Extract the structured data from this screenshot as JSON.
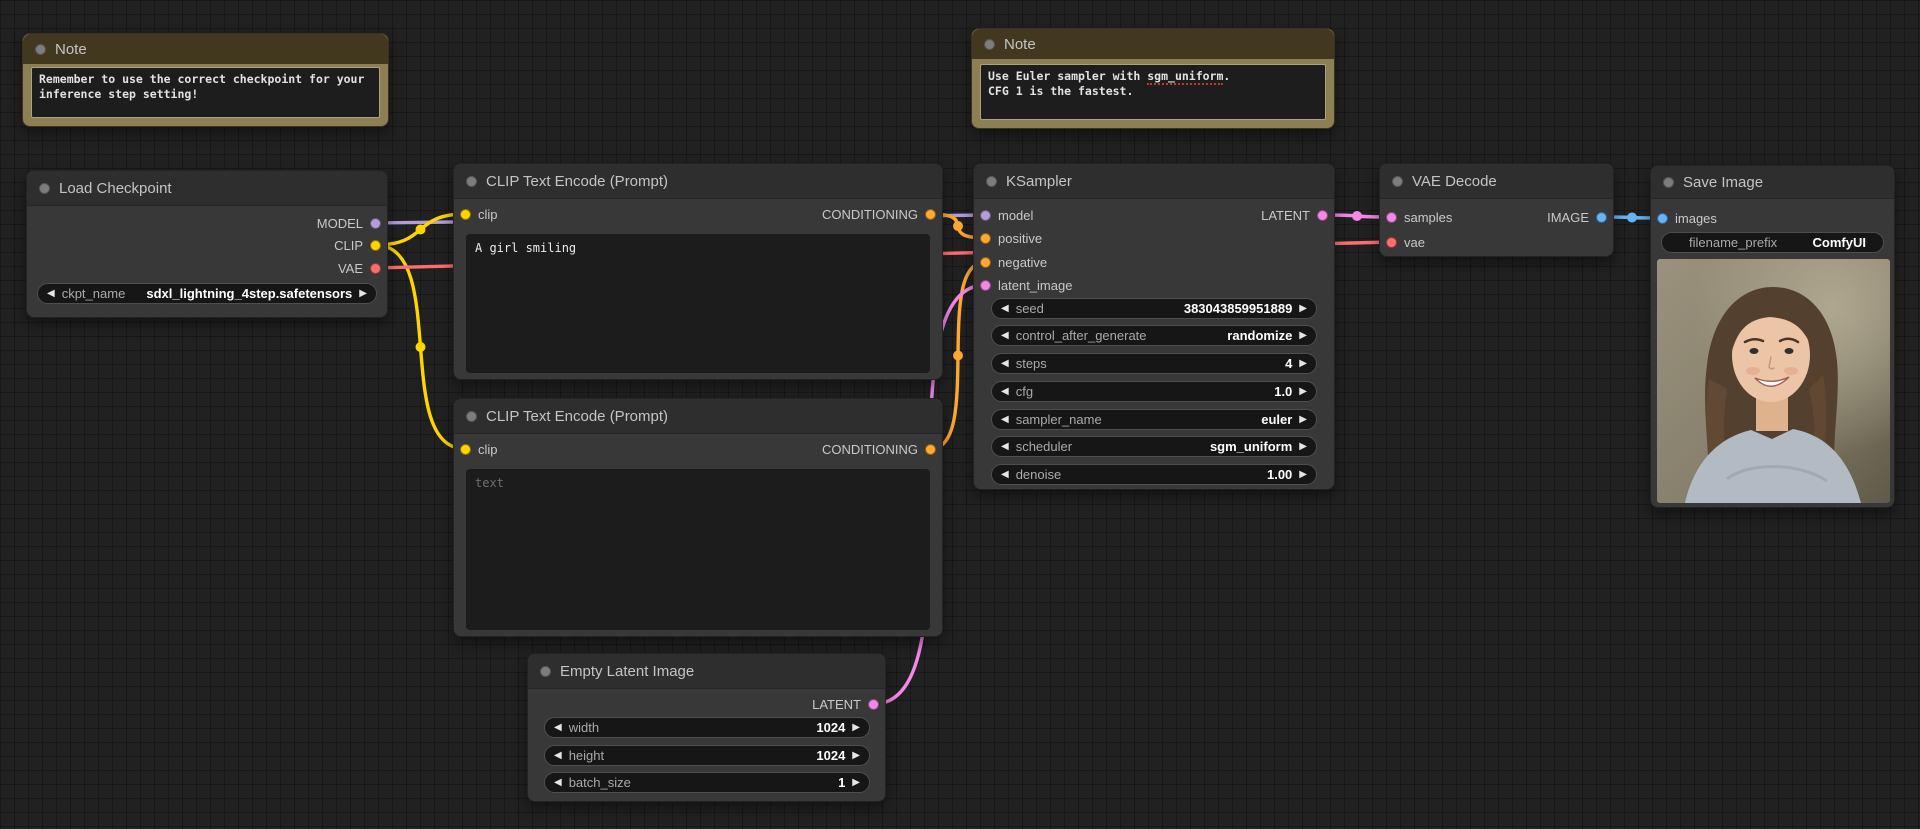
{
  "icons": {
    "arrow_left": "◀",
    "arrow_right": "▶"
  },
  "type_colors": {
    "MODEL": "#B39DDB",
    "CLIP": "#FFD500",
    "VAE": "#FF6E6E",
    "CONDITIONING": "#FFA931",
    "LATENT": "#F487E8",
    "IMAGE": "#64B5F6"
  },
  "nodes": {
    "note1": {
      "title": "Note",
      "text": "Remember to use the correct checkpoint for your inference step setting!"
    },
    "note2": {
      "title": "Note",
      "line1_pre": "Use Euler sampler with ",
      "line1_mark": "sgm_uniform",
      "line1_post": ".",
      "line2": "CFG 1 is the fastest."
    },
    "load_checkpoint": {
      "title": "Load Checkpoint",
      "outputs": [
        "MODEL",
        "CLIP",
        "VAE"
      ],
      "widget": {
        "label": "ckpt_name",
        "value": "sdxl_lightning_4step.safetensors"
      }
    },
    "clip_positive": {
      "title": "CLIP Text Encode (Prompt)",
      "input": "clip",
      "output": "CONDITIONING",
      "text": "A girl smiling"
    },
    "clip_negative": {
      "title": "CLIP Text Encode (Prompt)",
      "input": "clip",
      "output": "CONDITIONING",
      "placeholder": "text"
    },
    "ksampler": {
      "title": "KSampler",
      "inputs": [
        "model",
        "positive",
        "negative",
        "latent_image"
      ],
      "output": "LATENT",
      "widgets": [
        {
          "label": "seed",
          "value": "383043859951889"
        },
        {
          "label": "control_after_generate",
          "value": "randomize"
        },
        {
          "label": "steps",
          "value": "4"
        },
        {
          "label": "cfg",
          "value": "1.0"
        },
        {
          "label": "sampler_name",
          "value": "euler"
        },
        {
          "label": "scheduler",
          "value": "sgm_uniform"
        },
        {
          "label": "denoise",
          "value": "1.00"
        }
      ]
    },
    "vae_decode": {
      "title": "VAE Decode",
      "inputs": [
        "samples",
        "vae"
      ],
      "output": "IMAGE"
    },
    "save_image": {
      "title": "Save Image",
      "input": "images",
      "widget": {
        "label": "filename_prefix",
        "value": "ComfyUI"
      }
    },
    "empty_latent": {
      "title": "Empty Latent Image",
      "output": "LATENT",
      "widgets": [
        {
          "label": "width",
          "value": "1024"
        },
        {
          "label": "height",
          "value": "1024"
        },
        {
          "label": "batch_size",
          "value": "1"
        }
      ]
    }
  },
  "links": [
    {
      "from": "lc:MODEL",
      "to": "ks:model",
      "type": "MODEL"
    },
    {
      "from": "lc:CLIP",
      "to": "c1:clip",
      "type": "CLIP"
    },
    {
      "from": "lc:CLIP",
      "to": "c2:clip",
      "type": "CLIP"
    },
    {
      "from": "lc:VAE",
      "to": "vd:vae",
      "type": "VAE"
    },
    {
      "from": "c1:CONDITIONING",
      "to": "ks:positive",
      "type": "CONDITIONING"
    },
    {
      "from": "c2:CONDITIONING",
      "to": "ks:negative",
      "type": "CONDITIONING"
    },
    {
      "from": "el:LATENT",
      "to": "ks:latent_image",
      "type": "LATENT"
    },
    {
      "from": "ks:LATENT",
      "to": "vd:samples",
      "type": "LATENT"
    },
    {
      "from": "vd:IMAGE",
      "to": "si:images",
      "type": "IMAGE"
    }
  ]
}
